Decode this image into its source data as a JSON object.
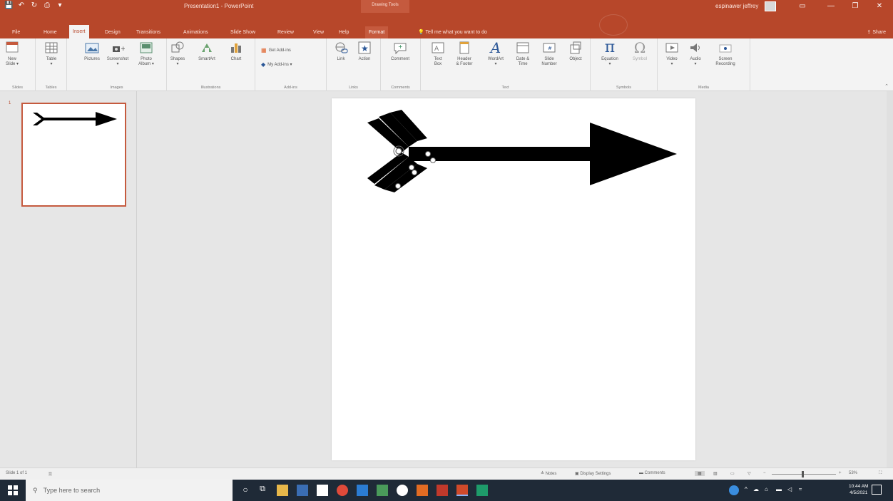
{
  "titlebar": {
    "quick_access": [
      "💾",
      "↶",
      "↻",
      "⎙",
      "▾"
    ],
    "doc_title": "Presentation1 - PowerPoint",
    "context_label": "Drawing Tools",
    "user_name": "espinawer jeffrey",
    "window_buttons": [
      "▭",
      "—",
      "❐",
      "✕"
    ]
  },
  "tabs": [
    {
      "label": "File"
    },
    {
      "label": "Home"
    },
    {
      "label": "Insert"
    },
    {
      "label": "Design"
    },
    {
      "label": "Transitions"
    },
    {
      "label": "Animations"
    },
    {
      "label": "Slide Show"
    },
    {
      "label": "Review"
    },
    {
      "label": "View"
    },
    {
      "label": "Help"
    },
    {
      "label": "Format"
    }
  ],
  "tellme": "Tell me what you want to do",
  "share": "Share",
  "ribbon": {
    "groups": {
      "slides": "Slides",
      "tables": "Tables",
      "images": "Images",
      "illustrations": "Illustrations",
      "addins": "Add-ins",
      "links": "Links",
      "comments": "Comments",
      "text": "Text",
      "symbols": "Symbols",
      "media": "Media"
    },
    "buttons": {
      "new_slide_1": "New",
      "new_slide_2": "Slide ▾",
      "table": "Table",
      "table_2": "▾",
      "pictures": "Pictures",
      "screenshot": "Screenshot",
      "screenshot_2": "▾",
      "photo_album_1": "Photo",
      "photo_album_2": "Album ▾",
      "shapes": "Shapes",
      "shapes_2": "▾",
      "smartart": "SmartArt",
      "chart": "Chart",
      "get_addins": "Get Add-ins",
      "my_addins": "My Add-ins ▾",
      "link": "Link",
      "action": "Action",
      "comment": "Comment",
      "text_box_1": "Text",
      "text_box_2": "Box",
      "header_footer_1": "Header",
      "header_footer_2": "& Footer",
      "wordart": "WordArt",
      "wordart_2": "▾",
      "date_time_1": "Date &",
      "date_time_2": "Time",
      "slide_number_1": "Slide",
      "slide_number_2": "Number",
      "object": "Object",
      "equation": "Equation",
      "equation_2": "▾",
      "symbol": "Symbol",
      "video": "Video",
      "video_2": "▾",
      "audio": "Audio",
      "audio_2": "▾",
      "screen_recording_1": "Screen",
      "screen_recording_2": "Recording"
    }
  },
  "thumbnails": {
    "slide_number": "1"
  },
  "statusbar": {
    "slide_info": "Slide 1 of 1",
    "notes": "Notes",
    "display_settings": "Display Settings",
    "comments": "Comments",
    "zoom": "53%"
  },
  "taskbar": {
    "search_placeholder": "Type here to search",
    "time": "10:44 AM",
    "date": "4/5/2021"
  },
  "colors": {
    "accent": "#b7472a",
    "ribbon_bg": "#f3f3f3",
    "canvas_bg": "#e6e6e6",
    "taskbar_bg": "#1f2a37"
  }
}
